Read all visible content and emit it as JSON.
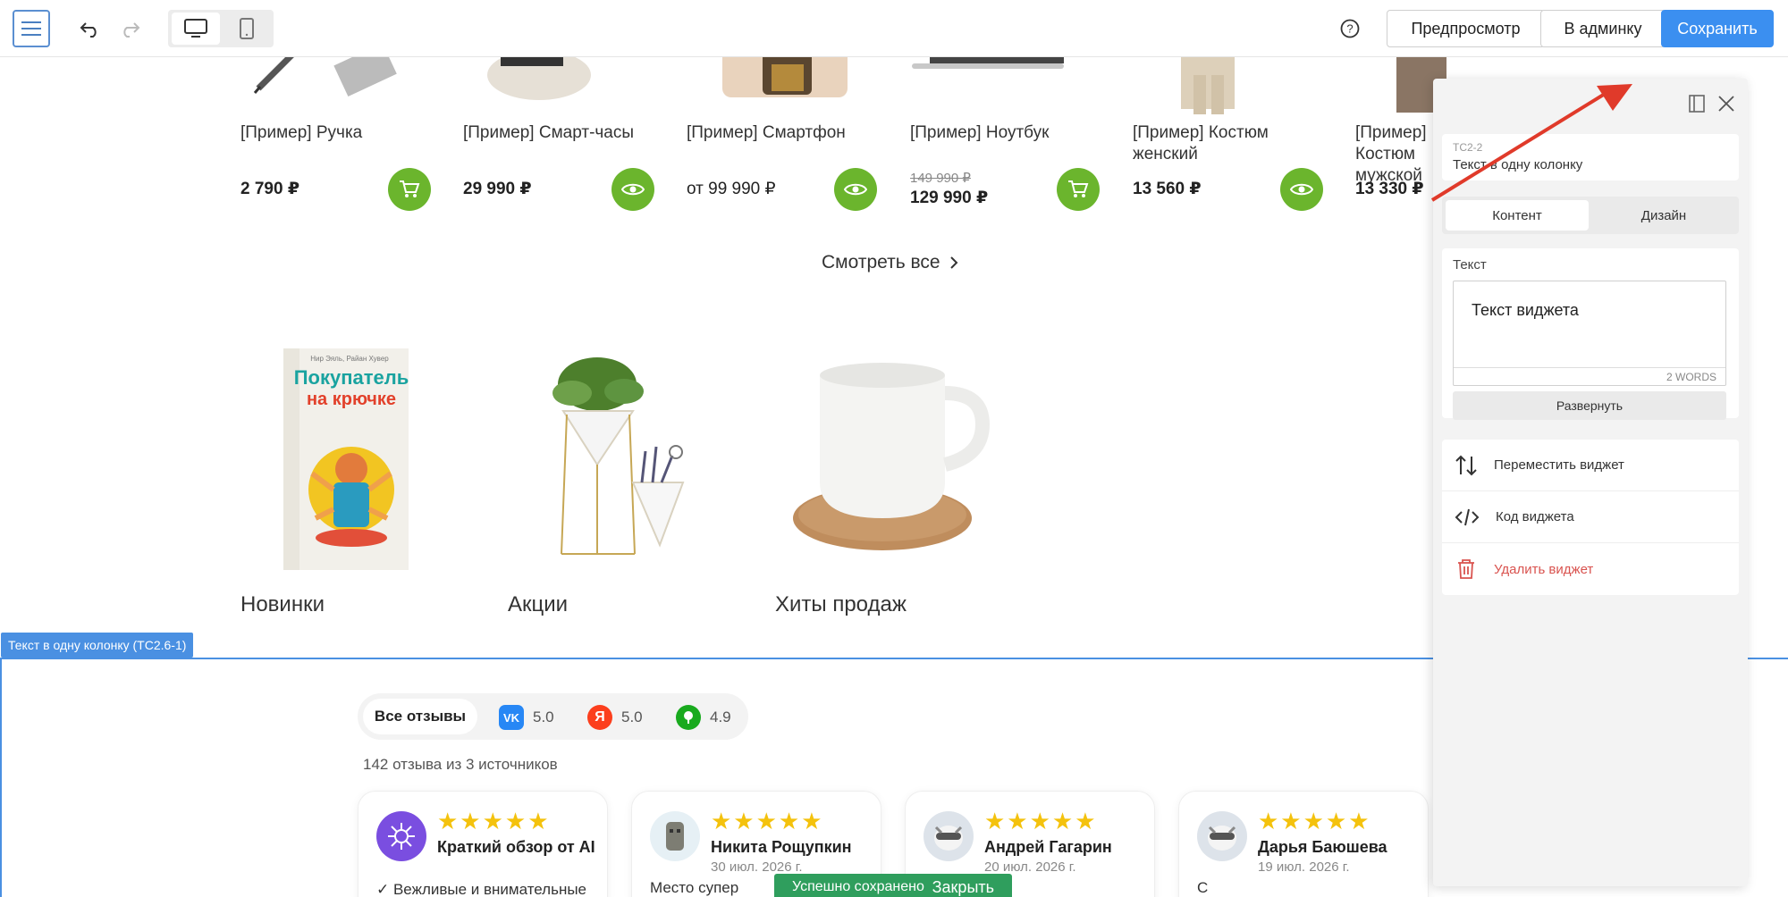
{
  "toolbar": {
    "preview_label": "Предпросмотр",
    "admin_label": "В админку",
    "save_label": "Сохранить"
  },
  "products": [
    {
      "name": "[Пример] Ручка",
      "price": "2 790 ₽",
      "button": "cart-icon"
    },
    {
      "name": "[Пример] Смарт-часы",
      "price": "29 990 ₽",
      "button": "eye-icon"
    },
    {
      "name": "[Пример] Смартфон",
      "price": "от 99 990 ₽",
      "button": "eye-icon"
    },
    {
      "name": "[Пример] Ноутбук",
      "old_price": "149 990 ₽",
      "price": "129 990 ₽",
      "button": "cart-icon"
    },
    {
      "name": "[Пример] Костюм женский",
      "price": "13 560 ₽",
      "button": "eye-icon"
    },
    {
      "name": "[Пример] Костюм мужской",
      "price": "13 330 ₽"
    }
  ],
  "see_all": "Смотреть все",
  "categories": [
    "Новинки",
    "Акции",
    "Хиты продаж"
  ],
  "book": {
    "authors": "Нир Эяль, Райан Хувер",
    "title_line1": "Покупатель",
    "title_line2": "на крючке"
  },
  "section_tag": "Текст в одну колонку (TC2.6-1)",
  "reviews": {
    "filter_all": "Все отзывы",
    "sources": [
      {
        "icon": "vk-icon",
        "letter": "VK",
        "rating": "5.0",
        "color": "#2787f5"
      },
      {
        "icon": "yandex-icon",
        "letter": "Я",
        "rating": "5.0",
        "color": "#fc3f1d"
      },
      {
        "icon": "2gis-icon",
        "letter": "",
        "rating": "4.9",
        "color": "#19aa1e"
      }
    ],
    "count_text": "142 отзыва из 3 источников",
    "cards": [
      {
        "name": "Краткий обзор от AI",
        "date": "",
        "text": "✓ Вежливые и внимательные"
      },
      {
        "name": "Никита Рощупкин",
        "date": "30 июл. 2026 г.",
        "text": "Место супер"
      },
      {
        "name": "Андрей Гагарин",
        "date": "20 июл. 2026 г.",
        "text": ""
      },
      {
        "name": "Дарья Баюшева",
        "date": "19 июл. 2026 г.",
        "text": "С"
      }
    ],
    "stars": "★★★★★"
  },
  "toast": {
    "message": "Успешно сохранено",
    "close": "Закрыть"
  },
  "panel": {
    "widget_id": "TC2-2",
    "widget_title": "Текст в одну колонку",
    "tab_content": "Контент",
    "tab_design": "Дизайн",
    "text_label": "Текст",
    "text_value": "Текст виджета",
    "word_count": "2 WORDS",
    "expand_label": "Развернуть",
    "actions": [
      {
        "icon": "move-icon",
        "label": "Переместить виджет"
      },
      {
        "icon": "code-icon",
        "label": "Код виджета"
      },
      {
        "icon": "trash-icon",
        "label": "Удалить виджет"
      }
    ]
  },
  "colors": {
    "accent": "#3b8ff0",
    "green": "#6bb52d",
    "danger": "#d9534f",
    "arrow": "#e03a2a"
  }
}
